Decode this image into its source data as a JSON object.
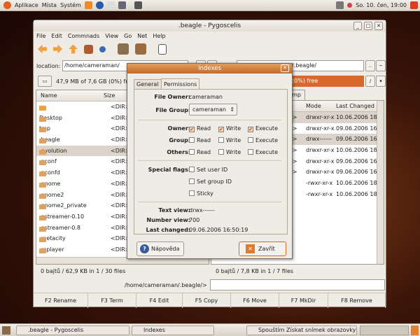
{
  "top_panel": {
    "menus": [
      "Aplikace",
      "Místa",
      "Systém"
    ],
    "clock": "So. 10. čen, 19:00"
  },
  "window": {
    "title": ".beagle - Pygoscelis",
    "menu": [
      "File",
      "Edit",
      "Commnads",
      "View",
      "Go",
      "Net",
      "Help"
    ]
  },
  "location": {
    "label": "location:",
    "left_path": "/home/cameraman/",
    "right_path": "/home/cameraman/.beagle/",
    "dots": "..",
    "tilde": "~"
  },
  "drive": {
    "left_free": "47,9 MB of 7,6 GB (0%) free",
    "right_free": "47,9 MB of 7,6 GB (0%) free",
    "slash": "/"
  },
  "left_panel": {
    "headers": [
      "Name",
      "Size"
    ],
    "rows": [
      {
        "name": "..",
        "size": "<DIR>"
      },
      {
        "name": "Desktop",
        "size": "<DIR>"
      },
      {
        "name": "tmp",
        "size": "<DIR>"
      },
      {
        "name": ".beagle",
        "size": "<DIR>"
      },
      {
        "name": ".evolution",
        "size": "<DIR>"
      },
      {
        "name": ".gconf",
        "size": "<DIR>"
      },
      {
        "name": ".gconfd",
        "size": "<DIR>"
      },
      {
        "name": ".gnome",
        "size": "<DIR>"
      },
      {
        "name": ".gnome2",
        "size": "<DIR>"
      },
      {
        "name": ".gnome2_private",
        "size": "<DIR>"
      },
      {
        "name": ".gstreamer-0.10",
        "size": "<DIR>"
      },
      {
        "name": ".gstreamer-0.8",
        "size": "<DIR>"
      },
      {
        "name": ".metacity",
        "size": "<DIR>"
      },
      {
        "name": ".mplayer",
        "size": "<DIR>"
      }
    ],
    "status": "0 bajtů / 62,9 KB  in  1 / 30 files"
  },
  "right_panel": {
    "tab": "tmp",
    "headers": [
      "Mode",
      "Last Changed"
    ],
    "rows": [
      {
        "size": "<DIR>",
        "mode": "drwxr-xr-x",
        "date": "10.06.2006 18"
      },
      {
        "size": "<DIR>",
        "mode": "drwxr-xr-x",
        "date": "09.06.2006 16"
      },
      {
        "size": "<DIR>",
        "mode": "drwx------",
        "date": "09.06.2006 16"
      },
      {
        "size": "<DIR>",
        "mode": "drwxr-xr-x",
        "date": "10.06.2006 18"
      },
      {
        "size": "<DIR>",
        "mode": "drwxr-xr-x",
        "date": "09.06.2006 16"
      },
      {
        "size": "<DIR>",
        "mode": "drwxr-xr-x",
        "date": "09.06.2006 16"
      },
      {
        "size": "bajtů",
        "mode": "-rwxr-xr-x",
        "date": "10.06.2006 18"
      },
      {
        "size": "bajtů",
        "mode": "-rwxr-xr-x",
        "date": "10.06.2006 18"
      }
    ],
    "status": "0 bajtů / 7,8 KB  in  1 / 7 files"
  },
  "command": {
    "prompt": "/home/cameraman/.beagle/>",
    "value": ""
  },
  "fkeys": [
    "F2 Rename",
    "F3 Term",
    "F4 Edit",
    "F5 Copy",
    "F6 Move",
    "F7 MkDir",
    "F8 Remove"
  ],
  "dialog": {
    "title": "Indexes",
    "tabs": [
      "General",
      "Permissions"
    ],
    "owner_label": "File Owner:",
    "owner": "cameraman",
    "group_label": "File Group:",
    "group": "cameraman",
    "perm_rows": [
      {
        "label": "Owner:",
        "checks": [
          true,
          true,
          true
        ]
      },
      {
        "label": "Group:",
        "checks": [
          false,
          false,
          false
        ]
      },
      {
        "label": "Others:",
        "checks": [
          false,
          false,
          false
        ]
      }
    ],
    "perm_cols": [
      "Read",
      "Write",
      "Execute"
    ],
    "special_label": "Special flags:",
    "special": [
      "Set user ID",
      "Set group ID",
      "Sticky"
    ],
    "text_view_label": "Text view:",
    "text_view": "drwx------",
    "number_view_label": "Number view:",
    "number_view": "700",
    "last_changed_label": "Last changed:",
    "last_changed": "09.06.2006 16:50:19",
    "help_button": "Nápověda",
    "close_button": "Zavřít"
  },
  "taskbar": {
    "tasks": [
      ".beagle - Pygoscelis",
      "Indexes",
      "Spouštím Získat snímek obrazovky"
    ]
  },
  "colors": {
    "accent": "#d8692a",
    "selection": "#dcd4ca"
  }
}
